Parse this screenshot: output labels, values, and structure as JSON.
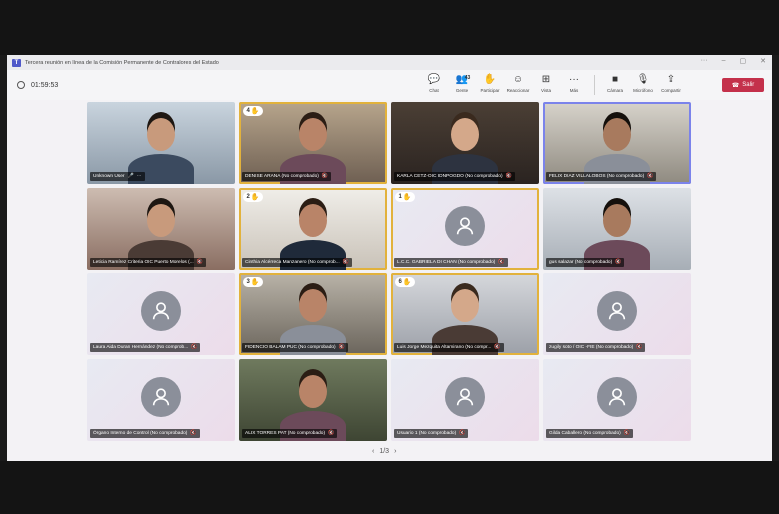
{
  "window": {
    "title": "Tercera reunión en línea de la Comisión Permanente de Contralores del Estado"
  },
  "timer": "01:59:53",
  "toolbar": {
    "chat": "Chat",
    "people": "Gente",
    "people_count": "43",
    "raise": "Participar",
    "react": "Reaccionar",
    "view": "Vista",
    "more": "Más",
    "camera": "Cámara",
    "mic": "Micrófono",
    "share": "Compartir",
    "leave": "Salir"
  },
  "participants": [
    {
      "name": "Unknown User",
      "mic_on": true,
      "hand": "",
      "kind": "video",
      "v": "v1",
      "state": ""
    },
    {
      "name": "DENISE ARANA (No comprobado)",
      "mic_on": false,
      "hand": "4",
      "kind": "video",
      "v": "v2",
      "state": "active"
    },
    {
      "name": "KARLA CETZ-OIC IDNPOGDO (No comprobado)",
      "mic_on": false,
      "hand": "",
      "kind": "video",
      "v": "v3",
      "state": ""
    },
    {
      "name": "FELIX DIAZ VILLALOBOS (No comprobado)",
      "mic_on": false,
      "hand": "",
      "kind": "video",
      "v": "v4",
      "state": "sel"
    },
    {
      "name": "Leticia Ramírez Criteria OIC Puerto Morelos (...",
      "mic_on": false,
      "hand": "",
      "kind": "video",
      "v": "v5",
      "state": ""
    },
    {
      "name": "Cinthia Alcérreca Manzanero (No comprob...",
      "mic_on": false,
      "hand": "2",
      "kind": "video",
      "v": "v6",
      "state": "active"
    },
    {
      "name": "L.C.C. GABRIELA DI CHAN (No comprobado)",
      "mic_on": false,
      "hand": "1",
      "kind": "avatar",
      "v": "",
      "state": "active"
    },
    {
      "name": "gus salazar (No comprobado)",
      "mic_on": false,
      "hand": "",
      "kind": "video",
      "v": "v7",
      "state": ""
    },
    {
      "name": "Laura Aida Duran Hernández (No comprob...",
      "mic_on": false,
      "hand": "",
      "kind": "avatar",
      "v": "",
      "state": ""
    },
    {
      "name": "FIDENCIO BALAM PUC (No comprobado)",
      "mic_on": false,
      "hand": "3",
      "kind": "video",
      "v": "v8",
      "state": "active"
    },
    {
      "name": "Luis Jorge Mezquita Altamirano (No compr...",
      "mic_on": false,
      "hand": "6",
      "kind": "video",
      "v": "v9",
      "state": "active"
    },
    {
      "name": "zugily soto / OIC -FIE (No comprobado)",
      "mic_on": false,
      "hand": "",
      "kind": "avatar",
      "v": "",
      "state": ""
    },
    {
      "name": "Órgano Interno de Control (No comprobado)",
      "mic_on": false,
      "hand": "",
      "kind": "avatar",
      "v": "",
      "state": ""
    },
    {
      "name": "ALIX TORRES PAT (No comprobado)",
      "mic_on": false,
      "hand": "",
      "kind": "video",
      "v": "v10",
      "state": ""
    },
    {
      "name": "Usuario 1 (No comprobado)",
      "mic_on": false,
      "hand": "",
      "kind": "avatar",
      "v": "",
      "state": ""
    },
    {
      "name": "Gilda Caballero (No comprobado)",
      "mic_on": false,
      "hand": "",
      "kind": "avatar",
      "v": "",
      "state": ""
    }
  ],
  "pager": {
    "label": "1/3"
  },
  "colors": {
    "leave": "#c4314b",
    "raised_hand": "#e2b23c",
    "selected": "#7b83eb"
  }
}
